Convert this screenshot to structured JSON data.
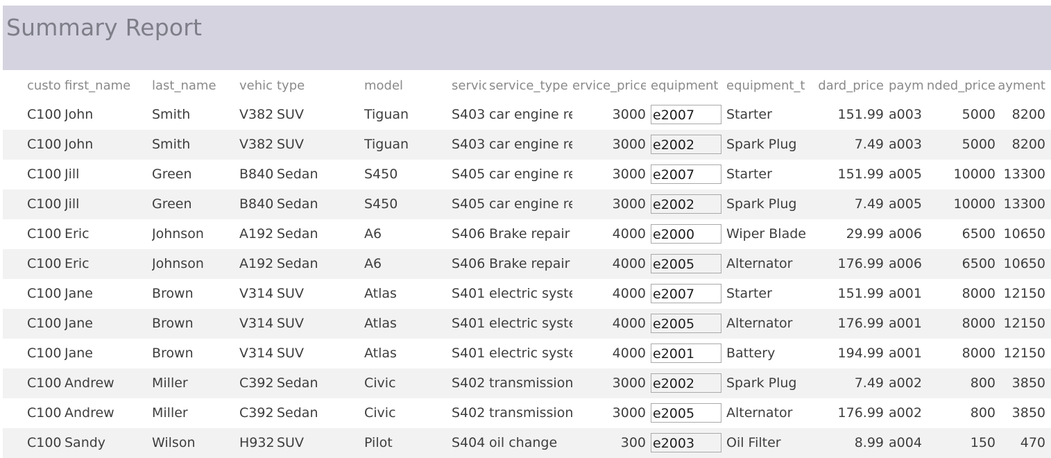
{
  "report": {
    "title": "Summary Report"
  },
  "columns": [
    {
      "key": "customer_id",
      "header": "custo"
    },
    {
      "key": "first_name",
      "header": "first_name"
    },
    {
      "key": "last_name",
      "header": "last_name"
    },
    {
      "key": "vehicle_id",
      "header": "vehic"
    },
    {
      "key": "type",
      "header": "type"
    },
    {
      "key": "model",
      "header": "model"
    },
    {
      "key": "service_id",
      "header": "servic"
    },
    {
      "key": "service_type",
      "header": "service_type"
    },
    {
      "key": "service_price",
      "header": "ervice_price"
    },
    {
      "key": "equipment_id",
      "header": "equipment"
    },
    {
      "key": "equipment_type",
      "header": "equipment_t"
    },
    {
      "key": "standard_price",
      "header": "dard_price"
    },
    {
      "key": "payment_id",
      "header": "paym"
    },
    {
      "key": "negotiated_price",
      "header": "nded_price"
    },
    {
      "key": "payment",
      "header": "ayment"
    }
  ],
  "rows": [
    [
      "C100",
      "John",
      "Smith",
      "V382",
      "SUV",
      "Tiguan",
      "S403",
      "car engine re",
      "3000",
      "e2007",
      "Starter",
      "151.99",
      "a003",
      "5000",
      "8200"
    ],
    [
      "C100",
      "John",
      "Smith",
      "V382",
      "SUV",
      "Tiguan",
      "S403",
      "car engine re",
      "3000",
      "e2002",
      "Spark Plug",
      "7.49",
      "a003",
      "5000",
      "8200"
    ],
    [
      "C100",
      "Jill",
      "Green",
      "B840",
      "Sedan",
      "S450",
      "S405",
      "car engine re",
      "3000",
      "e2007",
      "Starter",
      "151.99",
      "a005",
      "10000",
      "13300"
    ],
    [
      "C100",
      "Jill",
      "Green",
      "B840",
      "Sedan",
      "S450",
      "S405",
      "car engine re",
      "3000",
      "e2002",
      "Spark Plug",
      "7.49",
      "a005",
      "10000",
      "13300"
    ],
    [
      "C100",
      "Eric",
      "Johnson",
      "A192",
      "Sedan",
      "A6",
      "S406",
      "Brake repair",
      "4000",
      "e2000",
      "Wiper Blade",
      "29.99",
      "a006",
      "6500",
      "10650"
    ],
    [
      "C100",
      "Eric",
      "Johnson",
      "A192",
      "Sedan",
      "A6",
      "S406",
      "Brake repair",
      "4000",
      "e2005",
      "Alternator",
      "176.99",
      "a006",
      "6500",
      "10650"
    ],
    [
      "C100",
      "Jane",
      "Brown",
      "V314",
      "SUV",
      "Atlas",
      "S401",
      "electric syste",
      "4000",
      "e2007",
      "Starter",
      "151.99",
      "a001",
      "8000",
      "12150"
    ],
    [
      "C100",
      "Jane",
      "Brown",
      "V314",
      "SUV",
      "Atlas",
      "S401",
      "electric syste",
      "4000",
      "e2005",
      "Alternator",
      "176.99",
      "a001",
      "8000",
      "12150"
    ],
    [
      "C100",
      "Jane",
      "Brown",
      "V314",
      "SUV",
      "Atlas",
      "S401",
      "electric syste",
      "4000",
      "e2001",
      "Battery",
      "194.99",
      "a001",
      "8000",
      "12150"
    ],
    [
      "C100",
      "Andrew",
      "Miller",
      "C392",
      "Sedan",
      "Civic",
      "S402",
      "transmission",
      "3000",
      "e2002",
      "Spark Plug",
      "7.49",
      "a002",
      "800",
      "3850"
    ],
    [
      "C100",
      "Andrew",
      "Miller",
      "C392",
      "Sedan",
      "Civic",
      "S402",
      "transmission",
      "3000",
      "e2005",
      "Alternator",
      "176.99",
      "a002",
      "800",
      "3850"
    ],
    [
      "C100",
      "Sandy",
      "Wilson",
      "H932",
      "SUV",
      "Pilot",
      "S404",
      "oil change",
      "300",
      "e2003",
      "Oil Filter",
      "8.99",
      "a004",
      "150",
      "470"
    ]
  ]
}
